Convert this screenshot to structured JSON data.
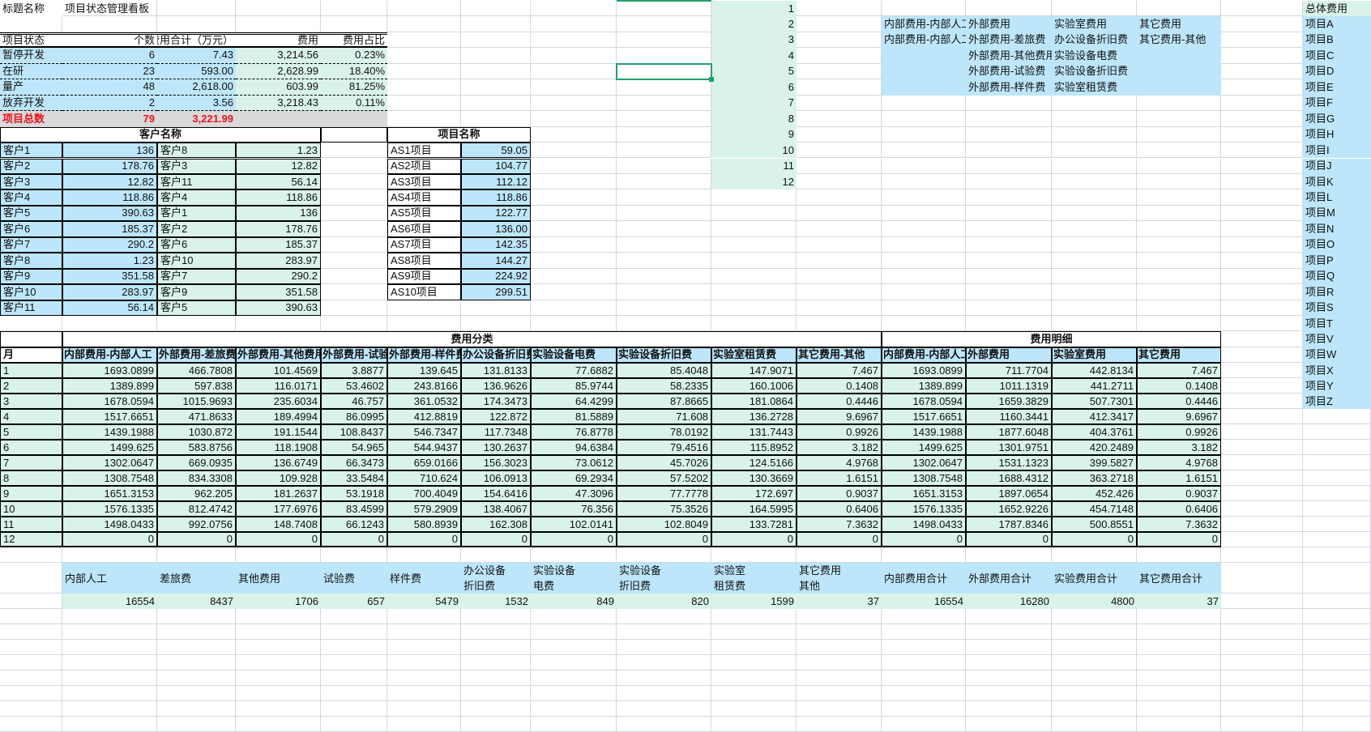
{
  "title_row": {
    "label": "标题名称",
    "value": "项目状态管理看板"
  },
  "status_table": {
    "headers": [
      "项目状态",
      "个数",
      "费用合计（万元）",
      "费用",
      "费用占比"
    ],
    "rows": [
      [
        "暂停开发",
        "6",
        "7.43",
        "3,214.56",
        "0.23%"
      ],
      [
        "在研",
        "23",
        "593.00",
        "2,628.99",
        "18.40%"
      ],
      [
        "量产",
        "48",
        "2,618.00",
        "603.99",
        "81.25%"
      ],
      [
        "放弃开发",
        "2",
        "3.56",
        "3,218.43",
        "0.11%"
      ]
    ],
    "total": {
      "label": "项目总数",
      "count": "79",
      "sum": "3,221.99"
    }
  },
  "customer_table": {
    "title": "客户名称",
    "rows": [
      [
        "客户1",
        "136",
        "客户8",
        "1.23"
      ],
      [
        "客户2",
        "178.76",
        "客户3",
        "12.82"
      ],
      [
        "客户3",
        "12.82",
        "客户11",
        "56.14"
      ],
      [
        "客户4",
        "118.86",
        "客户4",
        "118.86"
      ],
      [
        "客户5",
        "390.63",
        "客户1",
        "136"
      ],
      [
        "客户6",
        "185.37",
        "客户2",
        "178.76"
      ],
      [
        "客户7",
        "290.2",
        "客户6",
        "185.37"
      ],
      [
        "客户8",
        "1.23",
        "客户10",
        "283.97"
      ],
      [
        "客户9",
        "351.58",
        "客户7",
        "290.2"
      ],
      [
        "客户10",
        "283.97",
        "客户9",
        "351.58"
      ],
      [
        "客户11",
        "56.14",
        "客户5",
        "390.63"
      ]
    ]
  },
  "project_table": {
    "title": "项目名称",
    "rows": [
      [
        "AS1项目",
        "59.05"
      ],
      [
        "AS2项目",
        "104.77"
      ],
      [
        "AS3项目",
        "112.12"
      ],
      [
        "AS4项目",
        "118.86"
      ],
      [
        "AS5项目",
        "122.77"
      ],
      [
        "AS6项目",
        "136.00"
      ],
      [
        "AS7项目",
        "142.35"
      ],
      [
        "AS8项目",
        "144.27"
      ],
      [
        "AS9项目",
        "224.92"
      ],
      [
        "AS10项目",
        "299.51"
      ]
    ]
  },
  "index_numbers": [
    "1",
    "2",
    "3",
    "4",
    "5",
    "6",
    "7",
    "8",
    "9",
    "10",
    "11",
    "12"
  ],
  "category_legend": {
    "rows": [
      [
        "内部费用-内部人工",
        "外部费用",
        "实验室费用",
        "其它费用"
      ],
      [
        "内部费用-内部人工",
        "外部费用-差旅费",
        "办公设备折旧费",
        "其它费用-其他"
      ],
      [
        "",
        "外部费用-其他费用",
        "实验设备电费",
        ""
      ],
      [
        "",
        "外部费用-试验费",
        "实验设备折旧费",
        ""
      ],
      [
        "",
        "外部费用-样件费",
        "实验室租赁费",
        ""
      ]
    ]
  },
  "project_list": {
    "header": "总体费用",
    "items": [
      "项目A",
      "项目B",
      "项目C",
      "项目D",
      "项目E",
      "项目F",
      "项目G",
      "项目H",
      "项目I",
      "项目J",
      "项目K",
      "项目L",
      "项目M",
      "项目N",
      "项目O",
      "项目P",
      "项目Q",
      "项目R",
      "项目S",
      "项目T",
      "项目V",
      "项目W",
      "项目X",
      "项目Y",
      "项目Z"
    ]
  },
  "expense_table": {
    "group_headers": {
      "category": "费用分类",
      "detail": "费用明细"
    },
    "month_label": "月",
    "columns": [
      "内部费用-内部人工",
      "外部费用-差旅费",
      "外部费用-其他费用",
      "外部费用-试验费",
      "外部费用-样件费",
      "办公设备折旧费",
      "实验设备电费",
      "实验设备折旧费",
      "实验室租赁费",
      "其它费用-其他",
      "内部费用-内部人工",
      "外部费用",
      "实验室费用",
      "其它费用"
    ],
    "rows": [
      [
        "1",
        "1693.0899",
        "466.7808",
        "101.4569",
        "3.8877",
        "139.645",
        "131.8133",
        "77.6882",
        "85.4048",
        "147.9071",
        "7.467",
        "1693.0899",
        "711.7704",
        "442.8134",
        "7.467"
      ],
      [
        "2",
        "1389.899",
        "597.838",
        "116.0171",
        "53.4602",
        "243.8166",
        "136.9626",
        "85.9744",
        "58.2335",
        "160.1006",
        "0.1408",
        "1389.899",
        "1011.1319",
        "441.2711",
        "0.1408"
      ],
      [
        "3",
        "1678.0594",
        "1015.9693",
        "235.6034",
        "46.757",
        "361.0532",
        "174.3473",
        "64.4299",
        "87.8665",
        "181.0864",
        "0.4446",
        "1678.0594",
        "1659.3829",
        "507.7301",
        "0.4446"
      ],
      [
        "4",
        "1517.6651",
        "471.8633",
        "189.4994",
        "86.0995",
        "412.8819",
        "122.872",
        "81.5889",
        "71.608",
        "136.2728",
        "9.6967",
        "1517.6651",
        "1160.3441",
        "412.3417",
        "9.6967"
      ],
      [
        "5",
        "1439.1988",
        "1030.872",
        "191.1544",
        "108.8437",
        "546.7347",
        "117.7348",
        "76.8778",
        "78.0192",
        "131.7443",
        "0.9926",
        "1439.1988",
        "1877.6048",
        "404.3761",
        "0.9926"
      ],
      [
        "6",
        "1499.625",
        "583.8756",
        "118.1908",
        "54.965",
        "544.9437",
        "130.2637",
        "94.6384",
        "79.4516",
        "115.8952",
        "3.182",
        "1499.625",
        "1301.9751",
        "420.2489",
        "3.182"
      ],
      [
        "7",
        "1302.0647",
        "669.0935",
        "136.6749",
        "66.3473",
        "659.0166",
        "156.3023",
        "73.0612",
        "45.7026",
        "124.5166",
        "4.9768",
        "1302.0647",
        "1531.1323",
        "399.5827",
        "4.9768"
      ],
      [
        "8",
        "1308.7548",
        "834.3308",
        "109.928",
        "33.5484",
        "710.624",
        "106.0913",
        "69.2934",
        "57.5202",
        "130.3669",
        "1.6151",
        "1308.7548",
        "1688.4312",
        "363.2718",
        "1.6151"
      ],
      [
        "9",
        "1651.3153",
        "962.205",
        "181.2637",
        "53.1918",
        "700.4049",
        "154.6416",
        "47.3096",
        "77.7778",
        "172.697",
        "0.9037",
        "1651.3153",
        "1897.0654",
        "452.426",
        "0.9037"
      ],
      [
        "10",
        "1576.1335",
        "812.4742",
        "177.6976",
        "83.4599",
        "579.2909",
        "138.4067",
        "76.356",
        "75.3526",
        "164.5995",
        "0.6406",
        "1576.1335",
        "1652.9226",
        "454.7148",
        "0.6406"
      ],
      [
        "11",
        "1498.0433",
        "992.0756",
        "148.7408",
        "66.1243",
        "580.8939",
        "162.308",
        "102.0141",
        "102.8049",
        "133.7281",
        "7.3632",
        "1498.0433",
        "1787.8346",
        "500.8551",
        "7.3632"
      ],
      [
        "12",
        "0",
        "0",
        "0",
        "0",
        "0",
        "0",
        "0",
        "0",
        "0",
        "0",
        "0",
        "0",
        "0",
        "0"
      ]
    ]
  },
  "summary": {
    "labels": [
      "内部人工",
      "差旅费",
      "其他费用",
      "试验费",
      "样件费",
      "办公设备\n折旧费",
      "实验设备\n电费",
      "实验设备\n折旧费",
      "实验室\n租赁费",
      "其它费用\n其他",
      "内部费用合计",
      "外部费用合计",
      "实验费用合计",
      "其它费用合计"
    ],
    "values": [
      "16554",
      "8437",
      "1706",
      "657",
      "5479",
      "1532",
      "849",
      "820",
      "1599",
      "37",
      "16554",
      "16280",
      "4800",
      "37"
    ]
  },
  "colors": {
    "blue_fill": "#bde6fa",
    "green_fill": "#d9f2ea",
    "total_fill": "#d9d9d9",
    "total_text": "#e8141c",
    "selection": "#21a36b"
  }
}
